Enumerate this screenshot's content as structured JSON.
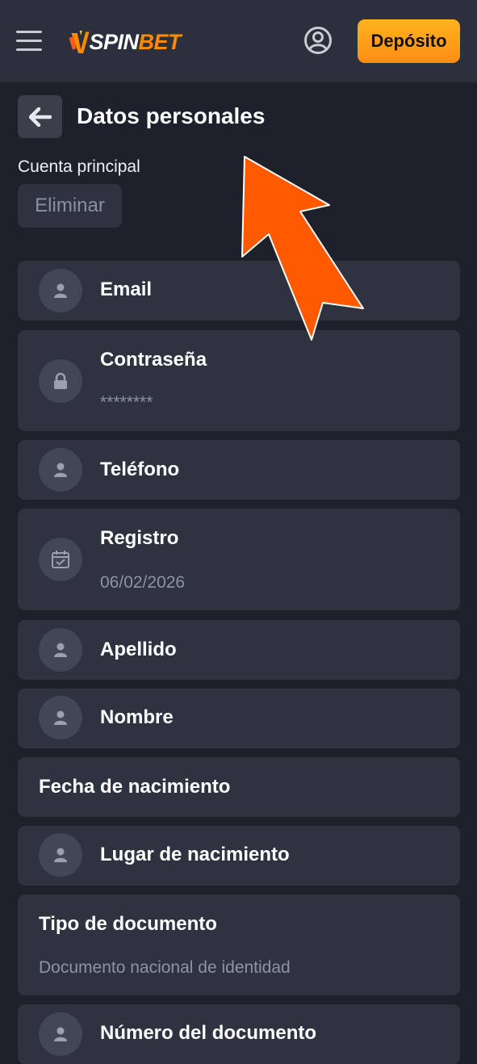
{
  "header": {
    "logo_spin": "SPIN",
    "logo_bet": "BET",
    "deposit_label": "Depósito",
    "accent_color": "#ff8c12",
    "icons": [
      "menu-icon",
      "user-circle-icon"
    ]
  },
  "page": {
    "title": "Datos personales",
    "account_label": "Cuenta principal",
    "delete_label": "Eliminar",
    "back_icon": "arrow-left-icon"
  },
  "fields": [
    {
      "label": "Email",
      "value": "",
      "icon": "user-icon"
    },
    {
      "label": "Contraseña",
      "value": "********",
      "icon": "lock-icon"
    },
    {
      "label": "Teléfono",
      "value": "",
      "icon": "user-icon"
    },
    {
      "label": "Registro",
      "value": "06/02/2026",
      "icon": "calendar-check-icon"
    },
    {
      "label": "Apellido",
      "value": "",
      "icon": "user-icon"
    },
    {
      "label": "Nombre",
      "value": "",
      "icon": "user-icon"
    },
    {
      "label": "Fecha de nacimiento",
      "value": "",
      "icon": ""
    },
    {
      "label": "Lugar de nacimiento",
      "value": "",
      "icon": "user-icon"
    },
    {
      "label": "Tipo de documento",
      "value": "Documento nacional de identidad",
      "icon": ""
    },
    {
      "label": "Número del documento",
      "value": "",
      "icon": "user-icon"
    }
  ],
  "overlay": {
    "arrow_color": "#ff5a00",
    "arrow_icon": "pointer-arrow-icon"
  }
}
